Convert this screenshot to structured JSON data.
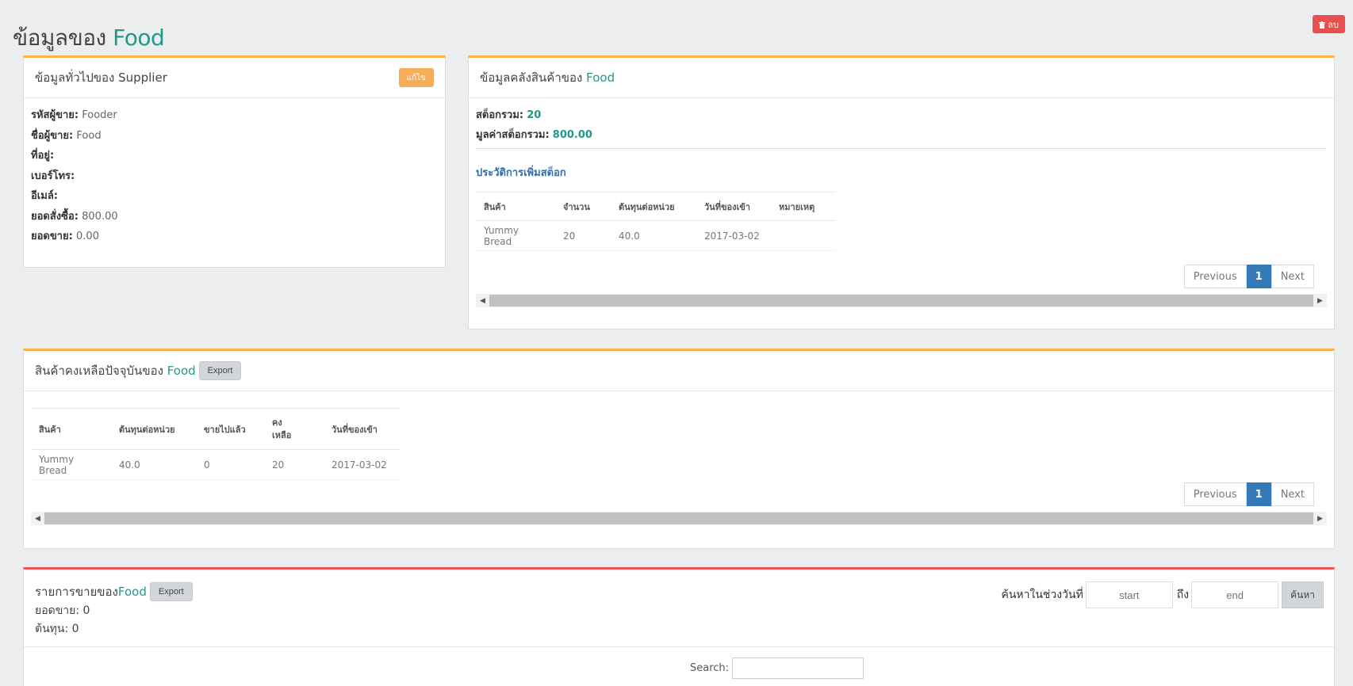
{
  "page": {
    "title_prefix": "ข้อมูลของ",
    "title_name": "Food",
    "delete_icon": "trash-icon",
    "delete_label": "ลบ"
  },
  "supplier_info": {
    "header": "ข้อมูลทั่วไปของ Supplier",
    "edit_label": "แก้ไข",
    "rows": [
      {
        "label": "รหัสผู้ขาย:",
        "value": "Fooder"
      },
      {
        "label": "ชื่อผู้ขาย:",
        "value": "Food"
      },
      {
        "label": "ที่อยู่:",
        "value": ""
      },
      {
        "label": "เบอร์โทร:",
        "value": ""
      },
      {
        "label": "อีเมล์:",
        "value": ""
      },
      {
        "label": "ยอดสั่งซื้อ:",
        "value": "800.00"
      },
      {
        "label": "ยอดขาย:",
        "value": "0.00"
      }
    ]
  },
  "stock_info": {
    "header_prefix": "ข้อมูลคลังสินค้าของ",
    "header_name": "Food",
    "total_stock_label": "สต็อกรวม:",
    "total_stock_value": "20",
    "stock_value_label": "มูลค่าสต็อกรวม:",
    "stock_value_value": "800.00",
    "history_title": "ประวัติการเพิ่มสต็อก",
    "columns": [
      "สินค้า",
      "จำนวน",
      "ต้นทุนต่อหน่วย",
      "วันที่ของเข้า",
      "หมายเหตุ"
    ],
    "rows": [
      [
        "Yummy Bread",
        "20",
        "40.0",
        "2017-03-02",
        ""
      ]
    ],
    "pager": {
      "previous": "Previous",
      "current": "1",
      "next": "Next"
    }
  },
  "remaining": {
    "header_prefix": "สินค้าคงเหลือปัจจุบันของ",
    "header_name": "Food",
    "export_label": "Export",
    "columns": [
      "สินค้า",
      "ต้นทุนต่อหน่วย",
      "ขายไปแล้ว",
      "คง\nเหลือ",
      "วันที่ของเข้า"
    ],
    "rows": [
      [
        "Yummy Bread",
        "40.0",
        "0",
        "20",
        "2017-03-02"
      ]
    ],
    "pager": {
      "previous": "Previous",
      "current": "1",
      "next": "Next"
    }
  },
  "sales": {
    "header_prefix": "รายการขายของ",
    "header_name": "Food",
    "export_label": "Export",
    "total_sales": "ยอดขาย: 0",
    "total_cost": "ต้นทุน: 0",
    "range_label": "ค้นหาในช่วงวันที่",
    "start_placeholder": "start",
    "to_label": "ถึง",
    "end_placeholder": "end",
    "search_button": "ค้นหา",
    "search_label": "Search:"
  },
  "colors": {
    "accent_teal": "#1f9a8a",
    "box_border_orange": "#f6b549",
    "box_border_red": "#ec5456",
    "pager_active": "#337ab7",
    "delete_button": "#e85050"
  }
}
